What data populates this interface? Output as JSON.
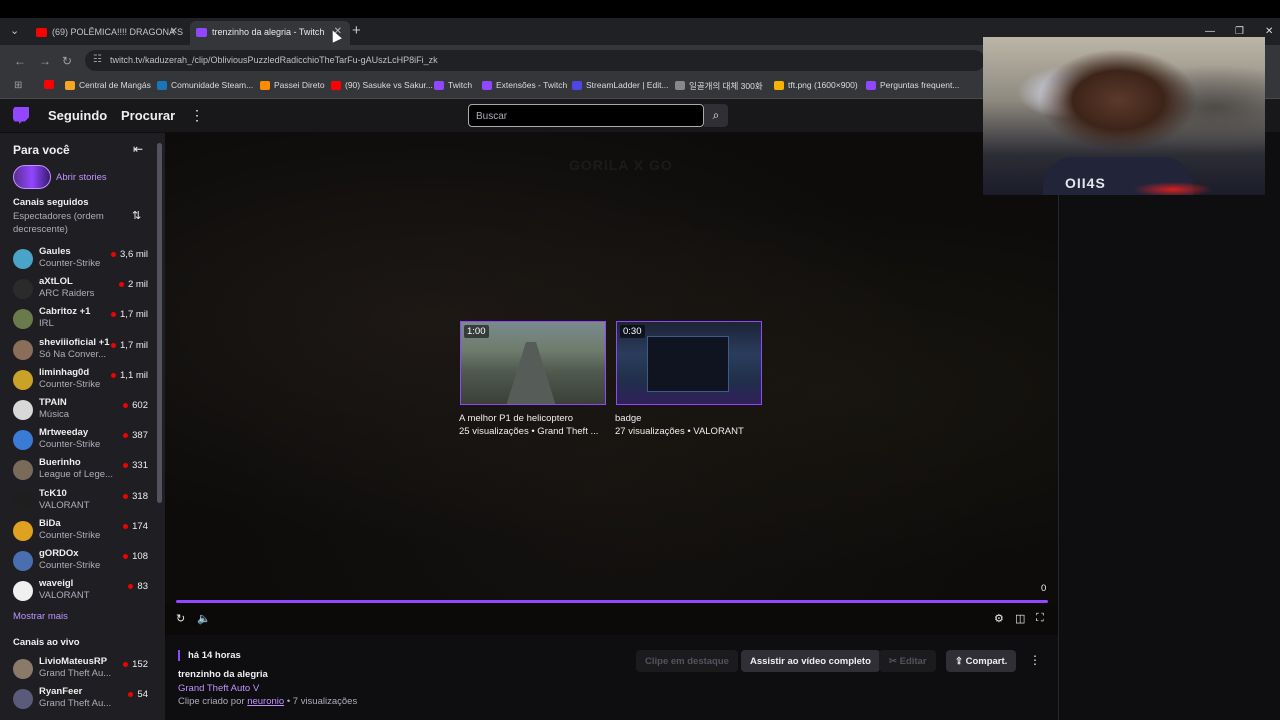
{
  "browser": {
    "tabs": [
      {
        "title": "(69) POLÊMICA!!!! DRAGONA S",
        "favicon_color": "#ff0000"
      },
      {
        "title": "trenzinho da alegria - Twitch",
        "favicon_color": "#9147ff"
      }
    ],
    "new_tab": "+",
    "url": "twitch.tv/kaduzerah_/clip/ObliviousPuzzledRadicchioTheTarFu-gAUszLcHP8iFi_zk",
    "bookmarks": [
      {
        "label": "Central de Mangás",
        "color": "#f5a623"
      },
      {
        "label": "Comunidade Steam...",
        "color": "#1b75bb"
      },
      {
        "label": "Passei Direto",
        "color": "#ff8a00"
      },
      {
        "label": "(90) Sasuke vs Sakur...",
        "color": "#ff0000"
      },
      {
        "label": "Twitch",
        "color": "#9147ff"
      },
      {
        "label": "Extensões - Twitch",
        "color": "#9147ff"
      },
      {
        "label": "StreamLadder | Edit...",
        "color": "#4f46e5"
      },
      {
        "label": "일골개의 대체 300화",
        "color": "#888888"
      },
      {
        "label": "tft.png (1600×900)",
        "color": "#f4b400"
      },
      {
        "label": "Perguntas frequent...",
        "color": "#9147ff"
      }
    ]
  },
  "twitch_nav": {
    "following": "Seguindo",
    "browse": "Procurar",
    "search_placeholder": "Buscar"
  },
  "sidebar": {
    "title": "Para você",
    "stories_label": "Abrir stories",
    "followed_heading": "Canais seguidos",
    "sort_label": "Espectadores (ordem decrescente)",
    "channels": [
      {
        "name": "Gaules",
        "game": "Counter-Strike",
        "viewers": "3,6 mil",
        "color": "#4aa3c9"
      },
      {
        "name": "aXtLOL",
        "game": "ARC Raiders",
        "viewers": "2 mil",
        "color": "#2b2b2b"
      },
      {
        "name": "Cabritoz +1",
        "game": "IRL",
        "viewers": "1,7 mil",
        "color": "#6b7a4a"
      },
      {
        "name": "sheviiioficial +1",
        "game": "Só Na Conver...",
        "viewers": "1,7 mil",
        "color": "#8a6e5a"
      },
      {
        "name": "liminhag0d",
        "game": "Counter-Strike",
        "viewers": "1,1 mil",
        "color": "#c9a227"
      },
      {
        "name": "TPAIN",
        "game": "Música",
        "viewers": "602",
        "color": "#d8d8d8"
      },
      {
        "name": "Mrtweeday",
        "game": "Counter-Strike",
        "viewers": "387",
        "color": "#3a7bd5"
      },
      {
        "name": "Buerinho",
        "game": "League of Lege...",
        "viewers": "331",
        "color": "#7a6a5a"
      },
      {
        "name": "TcK10",
        "game": "VALORANT",
        "viewers": "318",
        "color": "#1e1e1e"
      },
      {
        "name": "BiDa",
        "game": "Counter-Strike",
        "viewers": "174",
        "color": "#e0a020"
      },
      {
        "name": "gORDOx",
        "game": "Counter-Strike",
        "viewers": "108",
        "color": "#4a6fb0"
      },
      {
        "name": "waveigl",
        "game": "VALORANT",
        "viewers": "83",
        "color": "#f0f0f0"
      }
    ],
    "show_more": "Mostrar mais",
    "live_heading": "Canais ao vivo",
    "live_channels": [
      {
        "name": "LivioMateusRP",
        "game": "Grand Theft Au...",
        "viewers": "152",
        "color": "#8a7a6a"
      },
      {
        "name": "RyanFeer",
        "game": "Grand Theft Au...",
        "viewers": "54",
        "color": "#5a5a7a"
      }
    ]
  },
  "player": {
    "bg_logo": "GORILA X GO",
    "recommended": [
      {
        "duration": "1:00",
        "title": "A melhor P1 de helicoptero",
        "meta": "25 visualizações • Grand Theft ..."
      },
      {
        "duration": "0:30",
        "title": "badge",
        "meta": "27 visualizações • VALORANT"
      }
    ],
    "countdown": "0",
    "progress_fraction": 1.0
  },
  "clip": {
    "time_ago": "há 14 horas",
    "title": "trenzinho da alegria",
    "game": "Grand Theft Auto V",
    "creator_prefix": "Clipe criado por",
    "creator": "neuronio",
    "views": "• 7 visualizações",
    "buttons": {
      "featured": "Clipe em destaque",
      "watch_full": "Assistir ao vídeo completo",
      "edit": "Editar",
      "share": "Compart."
    }
  },
  "webcam": {
    "shirt_text": "OII4S"
  }
}
